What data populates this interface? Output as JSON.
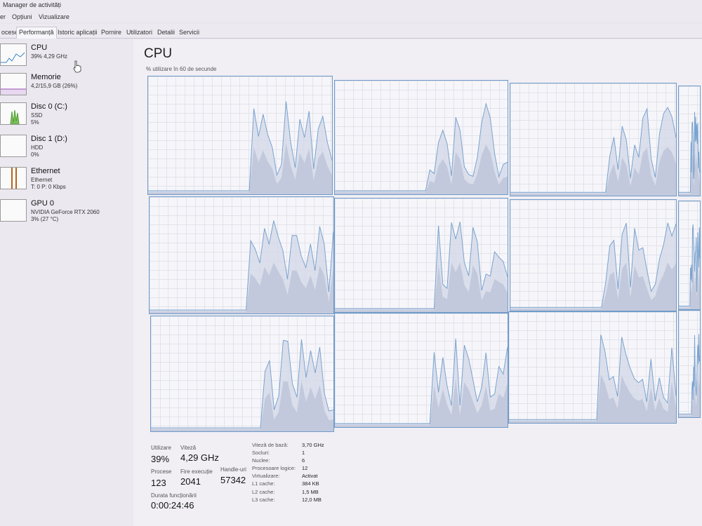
{
  "window": {
    "title": "Manager de activități"
  },
  "menu": [
    "er",
    "Opțiuni",
    "Vizualizare"
  ],
  "tabs": [
    {
      "label": "ocese",
      "active": false
    },
    {
      "label": "Performanță",
      "active": true
    },
    {
      "label": "Istoric aplicații",
      "active": false
    },
    {
      "label": "Pornire",
      "active": false
    },
    {
      "label": "Utilizatori",
      "active": false
    },
    {
      "label": "Detalii",
      "active": false
    },
    {
      "label": "Servicii",
      "active": false
    }
  ],
  "sidebar": {
    "items": [
      {
        "name": "CPU",
        "line2": "39% 4,29 GHz",
        "line3": "",
        "selected": true,
        "color": "#3c86c8"
      },
      {
        "name": "Memorie",
        "line2": "4,2/15,9 GB (26%)",
        "line3": "",
        "selected": false,
        "color": "#9a4fb3"
      },
      {
        "name": "Disc 0 (C:)",
        "line2": "SSD",
        "line3": "5%",
        "selected": false,
        "color": "#4c9e2e"
      },
      {
        "name": "Disc 1 (D:)",
        "line2": "HDD",
        "line3": "0%",
        "selected": false,
        "color": "#4c9e2e"
      },
      {
        "name": "Ethernet",
        "line2": "Ethernet",
        "line3": "T: 0 P: 0 Kbps",
        "selected": false,
        "color": "#b5651d"
      },
      {
        "name": "GPU 0",
        "line2": "NVIDIA GeForce RTX 2060",
        "line3": "3% (27 °C)",
        "selected": false,
        "color": "#3c86c8"
      }
    ]
  },
  "main": {
    "heading": "CPU",
    "subcaption": "% utilizare în 60 de secunde",
    "graph_colors": {
      "line": "#7aa3cf",
      "fill": "#d4d9e8",
      "kernel_fill": "#c3c9dc"
    }
  },
  "stats": {
    "utilizare_label": "Utilizare",
    "utilizare_value": "39%",
    "viteza_label": "Viteză",
    "viteza_value": "4,29 GHz",
    "procese_label": "Procese",
    "procese_value": "123",
    "fire_label": "Fire execuție",
    "fire_value": "2041",
    "handle_label": "Handle-uri",
    "handle_value": "57342",
    "durata_label": "Durata funcționării",
    "durata_value": "0:00:24:46"
  },
  "details": [
    {
      "label": "Viteză de bază:",
      "value": "3,70 GHz"
    },
    {
      "label": "Socluri:",
      "value": "1"
    },
    {
      "label": "Nuclee:",
      "value": "6"
    },
    {
      "label": "Procesoare logice:",
      "value": "12"
    },
    {
      "label": "Virtualizare:",
      "value": "Activat"
    },
    {
      "label": "L1 cache:",
      "value": "384 KB"
    },
    {
      "label": "L2 cache:",
      "value": "1,5 MB"
    },
    {
      "label": "L3 cache:",
      "value": "12,0 MB"
    }
  ]
}
